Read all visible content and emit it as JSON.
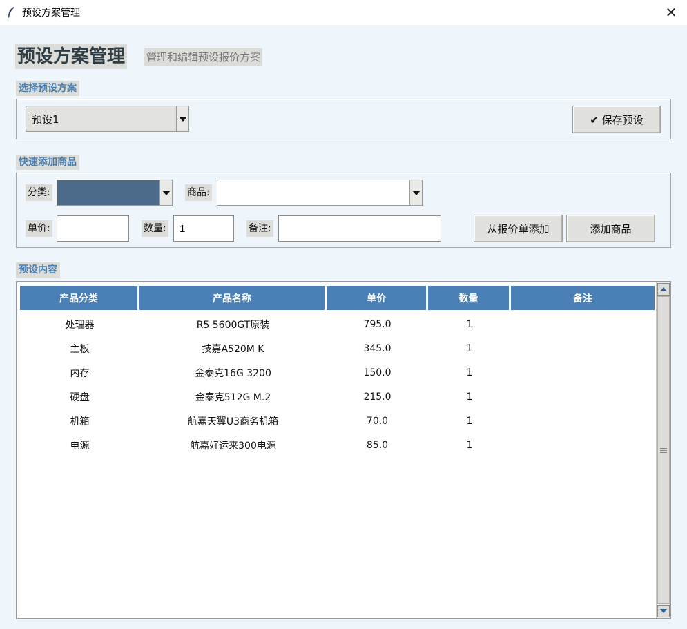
{
  "window": {
    "title": "预设方案管理",
    "close_symbol": "✕"
  },
  "header": {
    "title": "预设方案管理",
    "subtitle": "管理和编辑预设报价方案"
  },
  "select_section": {
    "label": "选择预设方案",
    "preset_value": "预设1",
    "save_button": "✔ 保存预设"
  },
  "quick_add": {
    "label": "快速添加商品",
    "category_label": "分类:",
    "category_value": "",
    "product_label": "商品:",
    "product_value": "",
    "price_label": "单价:",
    "price_value": "",
    "qty_label": "数量:",
    "qty_value": "1",
    "note_label": "备注:",
    "note_value": "",
    "from_quote_button": "从报价单添加",
    "add_button": "添加商品"
  },
  "content": {
    "label": "预设内容",
    "columns": [
      "产品分类",
      "产品名称",
      "单价",
      "数量",
      "备注"
    ],
    "rows": [
      [
        "处理器",
        "R5 5600GT原装",
        "795.0",
        "1",
        ""
      ],
      [
        "主板",
        "技嘉A520M K",
        "345.0",
        "1",
        ""
      ],
      [
        "内存",
        "金泰克16G 3200",
        "150.0",
        "1",
        ""
      ],
      [
        "硬盘",
        "金泰克512G M.2",
        "215.0",
        "1",
        ""
      ],
      [
        "机箱",
        "航嘉天翼U3商务机箱",
        "70.0",
        "1",
        ""
      ],
      [
        "电源",
        "航嘉好运来300电源",
        "85.0",
        "1",
        ""
      ]
    ]
  },
  "colors": {
    "header_bg": "#4a80b6",
    "section_label": "#4a7fb0",
    "selected_combo": "#4b6a8a"
  },
  "icons": {
    "app": "feather-icon",
    "close": "close-icon",
    "dropdown": "chevron-down-icon"
  }
}
